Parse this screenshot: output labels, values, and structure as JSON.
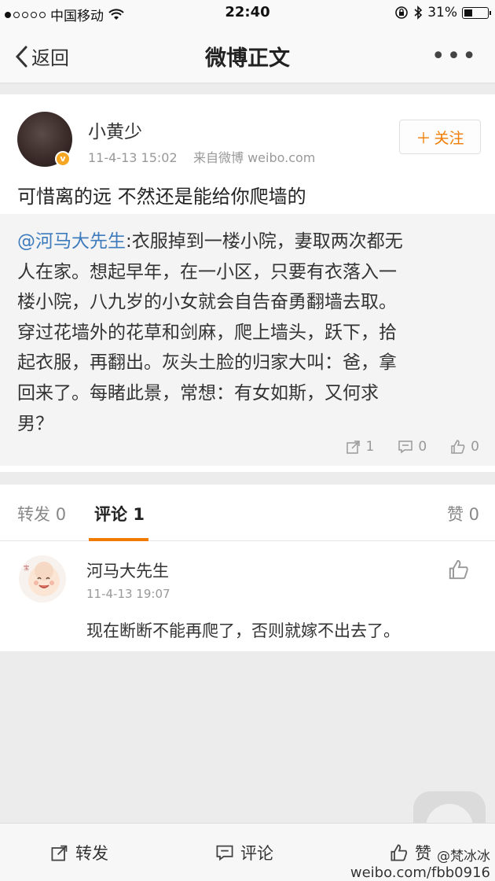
{
  "status_bar": {
    "carrier": "中国移动",
    "time": "22:40",
    "battery": "31%",
    "battery_level": 0.31,
    "icons": [
      "signal-dots-icon",
      "wifi-icon",
      "lock-rotation-icon",
      "bluetooth-icon",
      "battery-icon"
    ]
  },
  "nav": {
    "back_label": "返回",
    "title": "微博正文",
    "more_label": "•••"
  },
  "post": {
    "author": "小黄少",
    "timestamp": "11-4-13 15:02",
    "source": "来自微博 weibo.com",
    "follow_label": "关注",
    "text": "可惜离的远 不然还是能给你爬墙的",
    "verified_badge": "v",
    "repost": {
      "mention": "@河马大先生",
      "body_lines": [
        ":衣服掉到一楼小院，妻取两次都无",
        "人在家。想起早年，在一小区，只要有衣落入一",
        "楼小院，八九岁的小女就会自告奋勇翻墙去取。",
        "穿过花墙外的花草和剑麻，爬上墙头，跃下，拾",
        "起衣服，再翻出。灰头土脸的归家大叫：爸，拿",
        "回来了。每睹此景，常想：有女如斯，又何求",
        "男？"
      ],
      "reposts": "1",
      "comments": "0",
      "likes": "0"
    }
  },
  "tabs": {
    "repost_label": "转发",
    "repost_count": "0",
    "comment_label": "评论",
    "comment_count": "1",
    "like_label": "赞",
    "like_count": "0"
  },
  "comment": {
    "author": "河马大先生",
    "timestamp": "11-4-13 19:07",
    "text": "现在断断不能再爬了，否则就嫁不出去了。"
  },
  "bottom_bar": {
    "repost_label": "转发",
    "comment_label": "评论",
    "like_label": "赞"
  },
  "watermark": {
    "handle": "@梵冰冰",
    "url": "weibo.com/fbb0916"
  },
  "colors": {
    "accent_orange": "#f07b00",
    "mention_blue": "#3d7bbd",
    "verified_gold": "#f5a623"
  }
}
